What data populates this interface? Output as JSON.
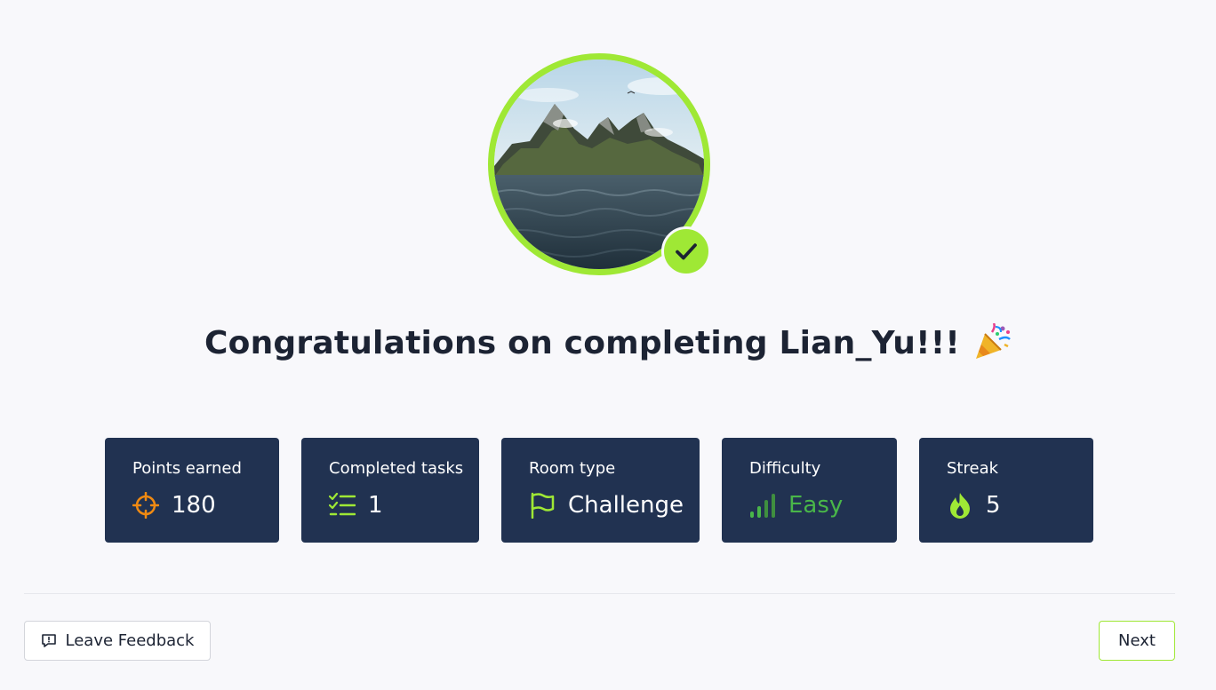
{
  "room": {
    "name": "Lian_Yu",
    "image_alt": "Lian_Yu room image"
  },
  "title": "Congratulations on completing Lian_Yu!!!",
  "stats": {
    "points": {
      "label": "Points earned",
      "value": "180",
      "icon": "crosshair-icon"
    },
    "tasks": {
      "label": "Completed tasks",
      "value": "1",
      "icon": "checklist-icon"
    },
    "room_type": {
      "label": "Room type",
      "value": "Challenge",
      "icon": "flag-icon"
    },
    "difficulty": {
      "label": "Difficulty",
      "value": "Easy",
      "icon": "signal-bars-icon"
    },
    "streak": {
      "label": "Streak",
      "value": "5",
      "icon": "flame-icon"
    }
  },
  "actions": {
    "feedback_label": "Leave Feedback",
    "next_label": "Next"
  },
  "colors": {
    "accent": "#9fe835",
    "card_bg": "#213251",
    "points_icon": "#f08a12",
    "easy": "#49b649"
  }
}
